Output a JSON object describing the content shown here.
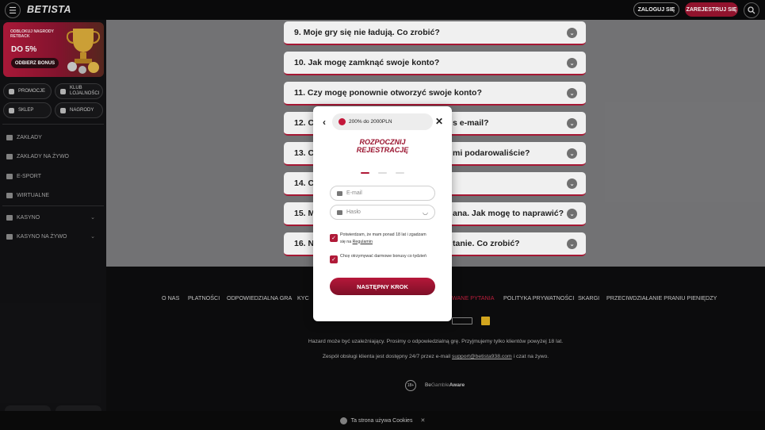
{
  "header": {
    "logo": "BETISTA",
    "login_label": "ZALOGUJ SIĘ",
    "register_label": "ZAREJESTRUJ SIĘ"
  },
  "sidebar": {
    "promo": {
      "label": "ODBLOKUJ NAGRODY RETBACK",
      "amount": "DO 5%",
      "button": "ODBIERZ BONUS"
    },
    "quick_buttons": [
      {
        "label": "PROMOCJE"
      },
      {
        "label": "KLUB LOJALNOŚCI"
      },
      {
        "label": "SKLEP"
      },
      {
        "label": "NAGRODY"
      }
    ],
    "nav": [
      {
        "label": "ZAKŁADY"
      },
      {
        "label": "ZAKŁADY NA ŻYWO"
      },
      {
        "label": "E-SPORT"
      },
      {
        "label": "WIRTUALNE"
      },
      {
        "label": "KASYNO"
      },
      {
        "label": "KASYNO NA ŻYWO"
      }
    ]
  },
  "faq": {
    "items": [
      {
        "q": "9. Moje gry się nie ładują. Co zrobić?"
      },
      {
        "q": "10. Jak mogę zamknąć swoje konto?"
      },
      {
        "q": "11. Czy mogę ponownie otworzyć swoje konto?"
      },
      {
        "q": "12. C",
        "tail": "s e-mail?"
      },
      {
        "q": "13. C",
        "tail": "mi podarowaliście?"
      },
      {
        "q": "14. C",
        "tail": ""
      },
      {
        "q": "15. M",
        "tail": "ana. Jak mogę to naprawić?"
      },
      {
        "q": "16. N",
        "tail": "tanie. Co zrobić?"
      }
    ]
  },
  "footer": {
    "links": [
      "O NAS",
      "PŁATNOŚCI",
      "ODPOWIEDZIALNA GRA",
      "KYC",
      "WANE PYTANIA",
      "POLITYKA PRYWATNOŚCI",
      "SKARGI",
      "PRZECIWDZIAŁANIE PRANIU PIENIĘDZY"
    ],
    "active_link_index": 4,
    "disclaimer": "Hazard może być uzależniający. Prosimy o odpowiedzialną grę. Przyjmujemy tylko klientów powyżej 18 lat.",
    "support": "Zespół obsługi klienta jest dostępny 24/7 przez e-mail ",
    "support_email": "support@betista938.com",
    "support_tail": " i czat na żywo.",
    "age": "18+",
    "begamble_prefix": "Be",
    "begamble_mid": "Gamble",
    "begamble_suffix": "Aware"
  },
  "cookie": {
    "text": "Ta strona używa Cookies",
    "close": "✕"
  },
  "modal": {
    "bonus_text": "200% do 2000PLN",
    "title_line1": "ROZPOCZNIJ",
    "title_line2": "REJESTRACJĘ",
    "email_placeholder": "E-mail",
    "password_placeholder": "Hasło",
    "consent_age_text": "Potwierdzam, że mam ponad 18 lat i zgadzam się na ",
    "consent_age_link": "Regulamin",
    "consent_bonus_text": "Chcę otrzymywać darmowe bonusy co tydzień",
    "next_button": "NASTĘPNY KROK",
    "step_current": 1,
    "step_total": 3
  },
  "colors": {
    "accent": "#b01a38",
    "accent_dark": "#9b1530"
  }
}
